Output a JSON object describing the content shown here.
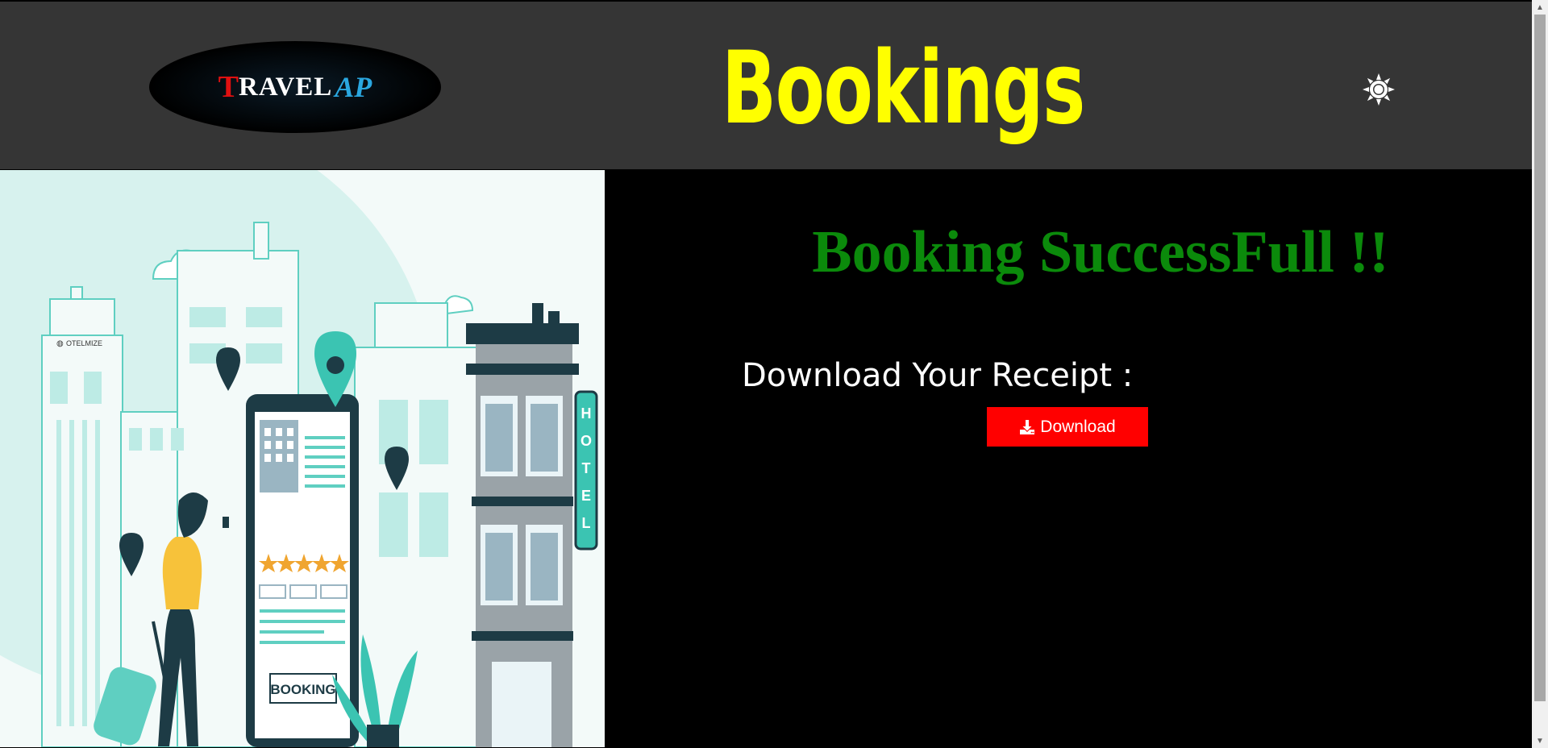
{
  "header": {
    "logo": {
      "t": "T",
      "ravel": "RAVEL",
      "ap": "AP"
    },
    "title": "Bookings",
    "theme_toggle_icon": "sun-icon"
  },
  "hero": {
    "hotel_brand": "OTELMIZE",
    "hotel_sign": [
      "H",
      "O",
      "T",
      "E",
      "L"
    ],
    "booking_label": "BOOKING",
    "rating_stars": 5
  },
  "main": {
    "success_message": "Booking SuccessFull !!",
    "receipt_label": "Download Your Receipt :",
    "download_button": {
      "label": "Download",
      "icon": "download-icon"
    }
  },
  "colors": {
    "header_bg": "#353535",
    "title": "#ffff00",
    "success": "#0b8a0b",
    "button_bg": "#ff0000"
  }
}
